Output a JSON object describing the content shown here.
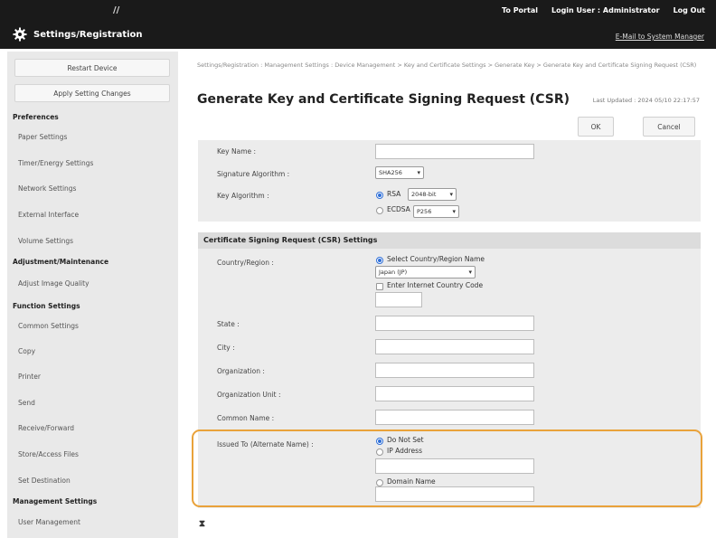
{
  "header": {
    "slashes": "//",
    "portal": "To Portal",
    "login_label": "Login User :",
    "login_user": "Administrator",
    "logout": "Log Out",
    "title": "Settings/Registration",
    "email": "E-Mail to System Manager"
  },
  "sidebar": {
    "buttons": [
      "Restart Device",
      "Apply Setting Changes"
    ],
    "sections": [
      {
        "title": "Preferences",
        "items": [
          "Paper Settings",
          "Timer/Energy Settings",
          "Network Settings",
          "External Interface",
          "Volume Settings"
        ]
      },
      {
        "title": "Adjustment/Maintenance",
        "items": [
          "Adjust Image Quality"
        ]
      },
      {
        "title": "Function Settings",
        "items": [
          "Common Settings",
          "Copy",
          "Printer",
          "Send",
          "Receive/Forward",
          "Store/Access Files",
          "Set Destination"
        ]
      },
      {
        "title": "Management Settings",
        "items": [
          "User Management"
        ]
      }
    ]
  },
  "main": {
    "breadcrumb": "Settings/Registration : Management Settings : Device Management > Key and Certificate Settings > Generate Key > Generate Key and Certificate Signing Request (CSR)",
    "title": "Generate Key and Certificate Signing Request (CSR)",
    "last_updated": "Last Updated : 2024 05/10 22:17:57",
    "ok": "OK",
    "cancel": "Cancel",
    "key": {
      "name_label": "Key Name :",
      "name_value": "",
      "sig_label": "Signature Algorithm :",
      "sig_value": "SHA256",
      "alg_label": "Key Algorithm :",
      "rsa_label": "RSA",
      "rsa_value": "2048-bit",
      "ecdsa_label": "ECDSA",
      "ecdsa_value": "P256",
      "selected": "RSA"
    },
    "csr": {
      "heading": "Certificate Signing Request (CSR) Settings",
      "country_label": "Country/Region :",
      "select_country": "Select Country/Region Name",
      "country_value": "Japan (JP)",
      "enter_code": "Enter Internet Country Code",
      "code_value": "",
      "state_label": "State :",
      "city_label": "City :",
      "org_label": "Organization :",
      "org_unit_label": "Organization Unit :",
      "common_name_label": "Common Name :",
      "issued_label": "Issued To (Alternate Name) :",
      "do_not_set": "Do Not Set",
      "ip_address": "IP Address",
      "domain_name": "Domain Name"
    }
  },
  "footer_icon": "sort-icon"
}
